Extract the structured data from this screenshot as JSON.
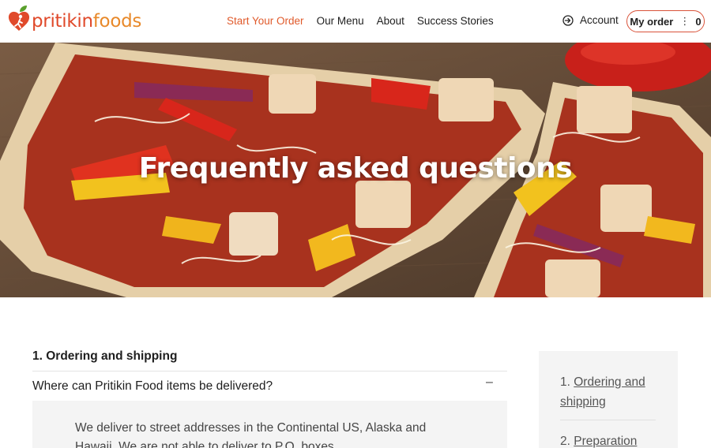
{
  "brand": {
    "name_part1": "pritikin",
    "name_part2": "foods",
    "primary_color": "#e04a2b",
    "secondary_color": "#e8892a",
    "accent_color": "#d9533a"
  },
  "nav": {
    "items": [
      {
        "label": "Start Your Order",
        "active": true
      },
      {
        "label": "Our Menu",
        "active": false
      },
      {
        "label": "About",
        "active": false
      },
      {
        "label": "Success Stories",
        "active": false
      }
    ]
  },
  "header": {
    "account_label": "Account",
    "account_icon": "login-icon",
    "order_label": "My order",
    "order_count": "0"
  },
  "hero": {
    "title": "Frequently asked questions"
  },
  "faq": {
    "section_title": "1. Ordering and shipping",
    "question": "Where can Pritikin Food items be delivered?",
    "collapse_symbol": "–",
    "answer": "We deliver to street addresses in the Continental US, Alaska and Hawaii. We are not able to deliver to P.O. boxes."
  },
  "toc": {
    "items": [
      {
        "number": "1.",
        "label": "Ordering and shipping"
      },
      {
        "number": "2.",
        "label": "Preparation"
      }
    ]
  }
}
